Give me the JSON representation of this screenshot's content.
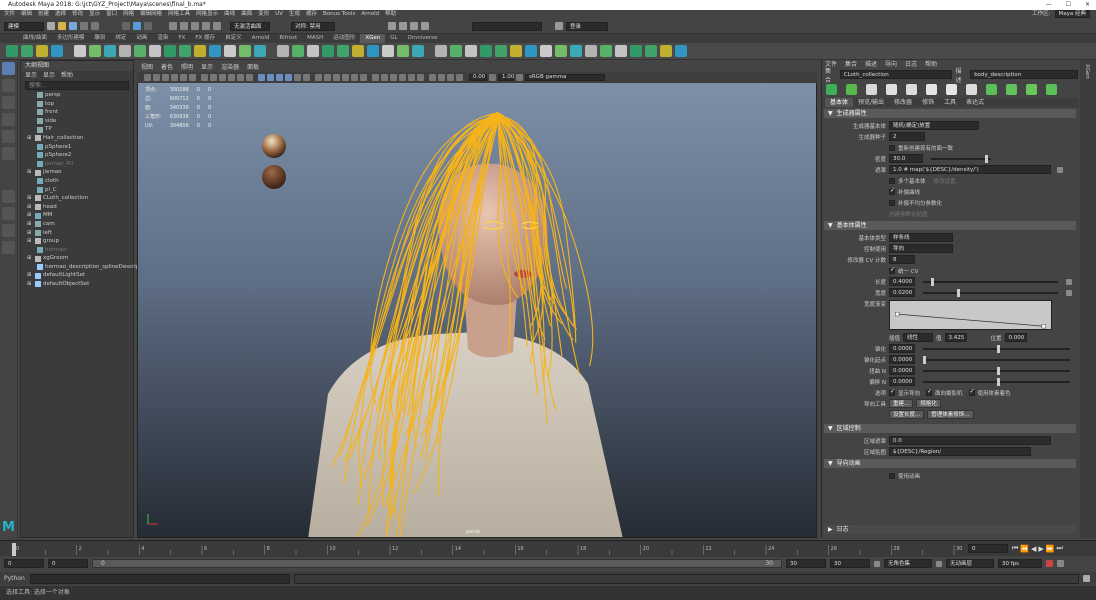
{
  "window": {
    "title": "Autodesk Maya 2018: G:\\jct\\GYZ_Project\\Maya\\scenes\\final_b.ma*"
  },
  "menubar": {
    "items": [
      "文件",
      "编辑",
      "创建",
      "选择",
      "修改",
      "显示",
      "窗口",
      "网格",
      "编辑网格",
      "网格工具",
      "网格显示",
      "曲线",
      "曲面",
      "变形",
      "UV",
      "生成",
      "缓存",
      "Bonus Tools",
      "Arnold",
      "帮助"
    ],
    "workspace_label": "工作区:",
    "workspace_value": "Maya 经典"
  },
  "statusline": {
    "mode": "建模",
    "no_live_surface": "无激活曲面",
    "symmetry": "对称: 禁用",
    "login": "登录"
  },
  "shelf": {
    "tabs": [
      "曲线/曲面",
      "多边形建模",
      "雕刻",
      "绑定",
      "动画",
      "渲染",
      "FX",
      "FX 缓存",
      "自定义",
      "Arnold",
      "Bifrost",
      "MASH",
      "运动图形",
      "XGen",
      "GL",
      "Omniverse"
    ],
    "active_tab": "XGen"
  },
  "outliner": {
    "title": "大纲视图",
    "menus": [
      "显示",
      "显示",
      "帮助"
    ],
    "search_placeholder": "搜索...",
    "items": [
      {
        "label": "persp",
        "indent": 1,
        "icon": "camera-icon"
      },
      {
        "label": "top",
        "indent": 1,
        "icon": "camera-icon"
      },
      {
        "label": "front",
        "indent": 1,
        "icon": "camera-icon"
      },
      {
        "label": "side",
        "indent": 1,
        "icon": "camera-icon"
      },
      {
        "label": "TP",
        "indent": 1,
        "icon": "camera-icon"
      },
      {
        "label": "Hair_collection",
        "indent": 0,
        "icon": "group-icon"
      },
      {
        "label": "pSphere1",
        "indent": 1,
        "icon": "mesh-icon"
      },
      {
        "label": "pSphere2",
        "indent": 1,
        "icon": "mesh-icon"
      },
      {
        "label": "jiemao_Rll",
        "indent": 1,
        "icon": "mesh-icon",
        "dim": true
      },
      {
        "label": "jiemao",
        "indent": 0,
        "icon": "group-icon"
      },
      {
        "label": "cloth",
        "indent": 1,
        "icon": "mesh-icon"
      },
      {
        "label": "pl_C",
        "indent": 1,
        "icon": "mesh-icon"
      },
      {
        "label": "CLoth_collection",
        "indent": 0,
        "icon": "group-icon"
      },
      {
        "label": "head",
        "indent": 0,
        "icon": "group-icon"
      },
      {
        "label": "MM",
        "indent": 0,
        "icon": "mesh-icon"
      },
      {
        "label": "cam",
        "indent": 0,
        "icon": "camera-icon"
      },
      {
        "label": "left",
        "indent": 0,
        "icon": "camera-icon"
      },
      {
        "label": "group",
        "indent": 0,
        "icon": "group-icon"
      },
      {
        "label": "hermao",
        "indent": 1,
        "icon": "mesh-icon",
        "dim": true
      },
      {
        "label": "xgGroom",
        "indent": 0,
        "icon": "group-icon"
      },
      {
        "label": "hermao_description_splineDescription",
        "indent": 1,
        "icon": "set-icon"
      },
      {
        "label": "defaultLightSet",
        "indent": 0,
        "icon": "set-icon"
      },
      {
        "label": "defaultObjectSet",
        "indent": 0,
        "icon": "set-icon"
      }
    ]
  },
  "viewport": {
    "menus": [
      "视图",
      "着色",
      "照明",
      "显示",
      "渲染器",
      "面板"
    ],
    "exposure": "0.00",
    "gamma": "1.00",
    "colorspace": "sRGB gamma",
    "camera_label": "persp",
    "hud": [
      {
        "k": "顶点:",
        "a": "300188",
        "b": "0",
        "c": "0"
      },
      {
        "k": "边:",
        "a": "600712",
        "b": "0",
        "c": "0"
      },
      {
        "k": "面:",
        "a": "340338",
        "b": "0",
        "c": "0"
      },
      {
        "k": "三角形:",
        "a": "630938",
        "b": "0",
        "c": "0"
      },
      {
        "k": "UV:",
        "a": "304806",
        "b": "0",
        "c": "0"
      }
    ]
  },
  "attr_editor": {
    "menus": [
      "文件",
      "集合",
      "描述",
      "导向",
      "日志",
      "帮助"
    ],
    "collection_label": "集合",
    "collection_value": "CLoth_collection",
    "description_label": "描述",
    "description_value": "body_description",
    "tabs": [
      "基本体",
      "预览/输出",
      "修改器",
      "修饰",
      "工具",
      "表达式"
    ],
    "sec1": "生成器属性",
    "generator_label": "生成器基本体",
    "generator_value": "随机(确定)放置",
    "seed_label": "生成器种子",
    "seed_value": "2",
    "reuse_label": "重新创建现有的面一致",
    "density_label": "密度",
    "density_value": "30.0",
    "mask_label": "遮罩",
    "mask_value": "1.0 # map('${DESC}/density/')",
    "multi_label": "多个基本体",
    "multi_dim": "修改设置...",
    "guides_label": "补偿曲线",
    "guides2_label": "补偿不均匀参数化",
    "create_guides": "创建参数化贴图",
    "sec2": "基本体属性",
    "prim_type_label": "基本体类型",
    "prim_type_value": "样条线",
    "control_label": "控制使用",
    "control_value": "导向",
    "cv_label": "修改器 CV 计数",
    "cv_value": "8",
    "cv_sync": "统一 CV",
    "length_label": "长度",
    "length_value": "0.4000",
    "width_label": "宽度",
    "width_value": "0.0200",
    "ramp_label": "宽度渐变",
    "interp_label": "插值",
    "interp_value": "线性",
    "value_label": "值",
    "value_value": "3.425",
    "pos_label": "位置",
    "pos_value": "0.000",
    "taper_label": "锥化",
    "taper_value": "0.0000",
    "taper_start_label": "锥化起点",
    "taper_start_value": "0.0000",
    "twist_label": "扭曲 N",
    "twist_value": "0.0000",
    "offset_label": "偏移 N",
    "offset_value": "0.0000",
    "opt_label": "选项",
    "opt1": "显示导向",
    "opt2": "面向摄影机",
    "opt3": "使用体素着色",
    "tools_label": "导向工具",
    "tools_btn1": "重建...",
    "tools_btn2": "规格化",
    "tools_btn3": "设置长度...",
    "tools_btn4": "管理体素修饰...",
    "sec3": "区域控制",
    "region_density_label": "区域遮罩",
    "region_density_value": "0.0",
    "region_map_label": "区域贴图",
    "region_map_value": "${DESC}/Region/",
    "sec4": "导向动画",
    "use_anim": "使用动画",
    "log_label": "日志"
  },
  "channel_box": {
    "label": "XGen"
  },
  "timeline": {
    "ticks": [
      "0",
      "2",
      "4",
      "6",
      "8",
      "10",
      "12",
      "14",
      "16",
      "18",
      "20",
      "22",
      "24",
      "26",
      "28",
      "30"
    ],
    "current_frame": "0"
  },
  "range": {
    "start": "0",
    "start2": "0",
    "slider_start": "0",
    "slider_end": "30",
    "end1": "30",
    "end2": "30",
    "char_set": "无角色集",
    "anim_layer": "无动画层",
    "fps": "30 fps"
  },
  "command": {
    "lang": "Python"
  },
  "help": {
    "text": "选择工具: 选择一个对象"
  }
}
